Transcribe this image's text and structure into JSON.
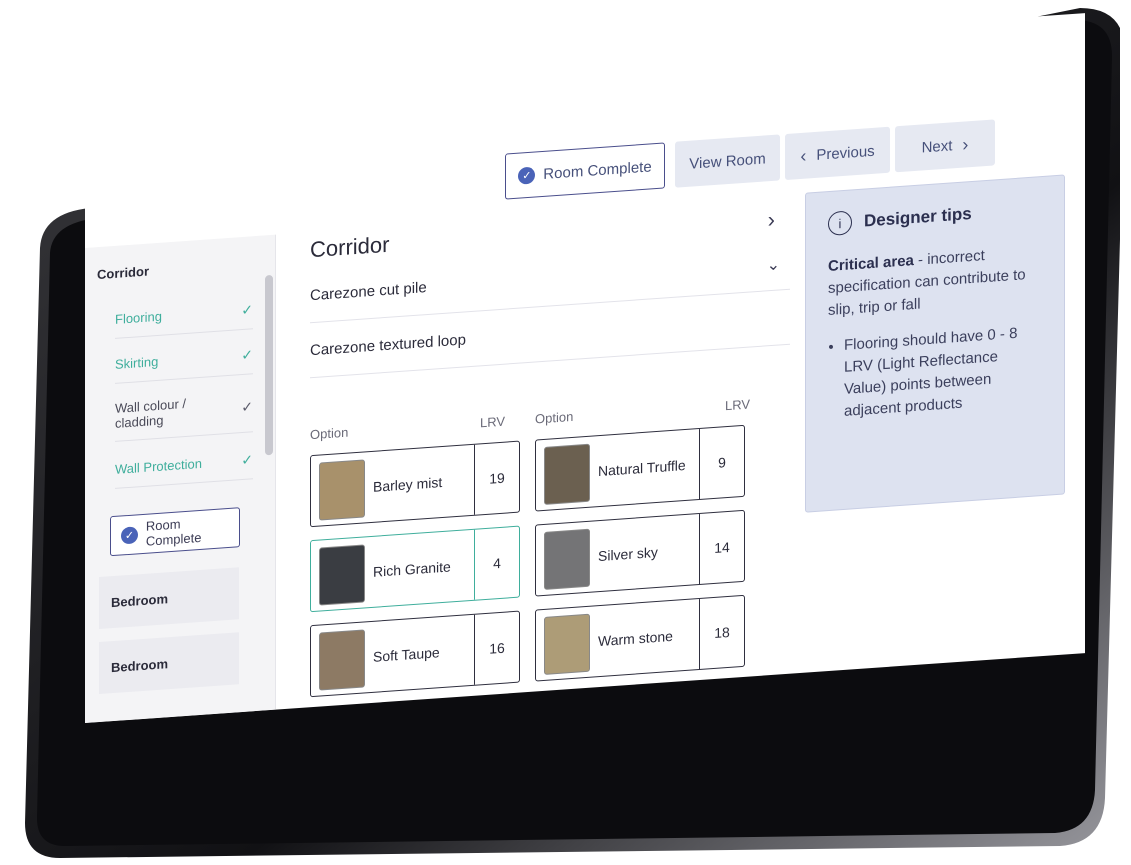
{
  "nav": {
    "room_complete_label": "Room Complete",
    "view_room_label": "View Room",
    "previous_label": "Previous",
    "next_label": "Next"
  },
  "sidebar": {
    "section_title": "Corridor",
    "items": [
      {
        "label": "Flooring",
        "done": true
      },
      {
        "label": "Skirting",
        "done": true
      },
      {
        "label": "Wall colour / cladding",
        "done": false
      },
      {
        "label": "Wall Protection",
        "done": true
      }
    ],
    "room_complete_label": "Room Complete",
    "rooms": [
      "Bedroom",
      "Bedroom"
    ]
  },
  "main": {
    "heading": "Corridor",
    "products": [
      "Carezone cut pile",
      "Carezone textured loop"
    ],
    "col_option": "Option",
    "col_lrv": "LRV",
    "options_left": [
      {
        "name": "Barley mist",
        "lrv": "19",
        "color": "#a8916b",
        "selected": false
      },
      {
        "name": "Rich Granite",
        "lrv": "4",
        "color": "#3a3d42",
        "selected": true
      },
      {
        "name": "Soft Taupe",
        "lrv": "16",
        "color": "#8d7a64",
        "selected": false
      }
    ],
    "options_right": [
      {
        "name": "Natural Truffle",
        "lrv": "9",
        "color": "#6b6050",
        "selected": false
      },
      {
        "name": "Silver sky",
        "lrv": "14",
        "color": "#747476",
        "selected": false
      },
      {
        "name": "Warm stone",
        "lrv": "18",
        "color": "#ad9c77",
        "selected": false
      }
    ]
  },
  "tips": {
    "title": "Designer tips",
    "critical_label": "Critical area",
    "critical_text": " - incorrect specification can contribute to slip, trip or fall",
    "bullet": "Flooring should have 0 - 8 LRV (Light Reflectance Value) points between adjacent products"
  }
}
